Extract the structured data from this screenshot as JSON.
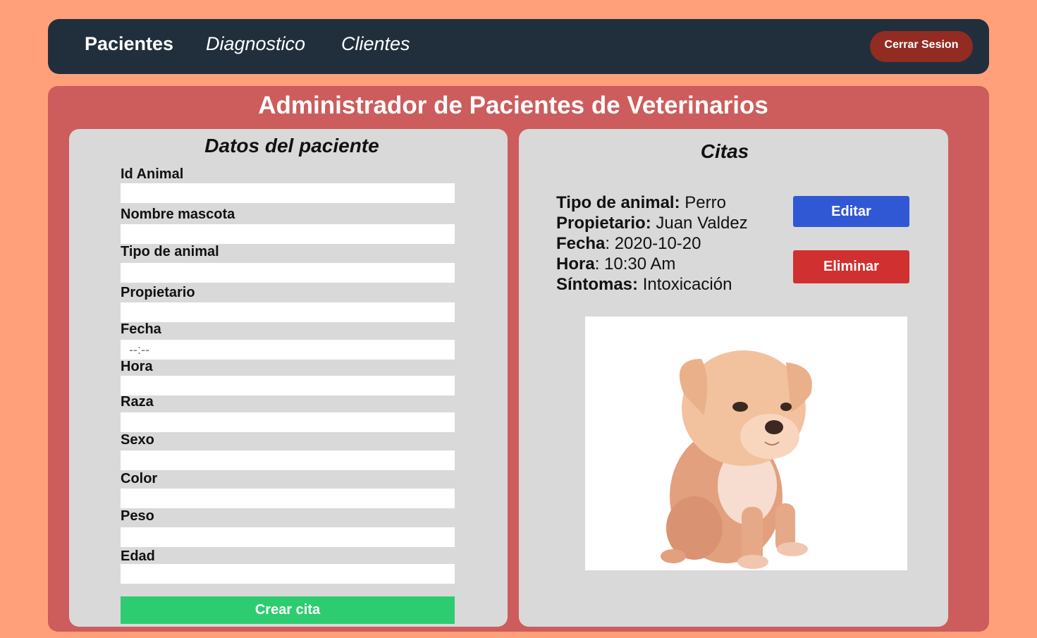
{
  "nav": {
    "items": [
      {
        "label": "Pacientes"
      },
      {
        "label": "Diagnostico"
      },
      {
        "label": "Clientes"
      }
    ],
    "logout_label": "Cerrar Sesion"
  },
  "main": {
    "title": "Administrador de Pacientes de Veterinarios"
  },
  "form": {
    "title": "Datos del paciente",
    "fields": [
      {
        "label": "Id Animal",
        "value": ""
      },
      {
        "label": "Nombre mascota",
        "value": ""
      },
      {
        "label": "Tipo de animal",
        "value": ""
      },
      {
        "label": "Propietario",
        "value": ""
      },
      {
        "label": "Fecha",
        "value": ""
      },
      {
        "label": "Hora",
        "value": ""
      },
      {
        "label": "Raza",
        "value": ""
      },
      {
        "label": "Sexo",
        "value": ""
      },
      {
        "label": "Color",
        "value": ""
      },
      {
        "label": "Peso",
        "value": ""
      },
      {
        "label": "Edad",
        "value": ""
      }
    ],
    "time_placeholder": "--:--",
    "submit_label": "Crear cita"
  },
  "citas": {
    "title": "Citas",
    "appointment": {
      "tipo_label": "Tipo de animal:",
      "tipo_value": "Perro",
      "propietario_label": "Propietario:",
      "propietario_value": "Juan Valdez",
      "fecha_label": "Fecha",
      "fecha_value": ": 2020-10-20",
      "hora_label": "Hora",
      "hora_value": ": 10:30 Am",
      "sintomas_label": "Síntomas:",
      "sintomas_value": "Intoxicación"
    },
    "edit_label": "Editar",
    "delete_label": "Eliminar",
    "photo_subject": "puppy"
  },
  "colors": {
    "page_bg": "#ffa07a",
    "nav_bg": "#212f3d",
    "logout_bg": "#922b21",
    "main_bg": "#cd5c5c",
    "panel_bg": "#d9d9d9",
    "create_btn": "#2ecc71",
    "edit_btn": "#3158d4",
    "delete_btn": "#d0302f"
  }
}
